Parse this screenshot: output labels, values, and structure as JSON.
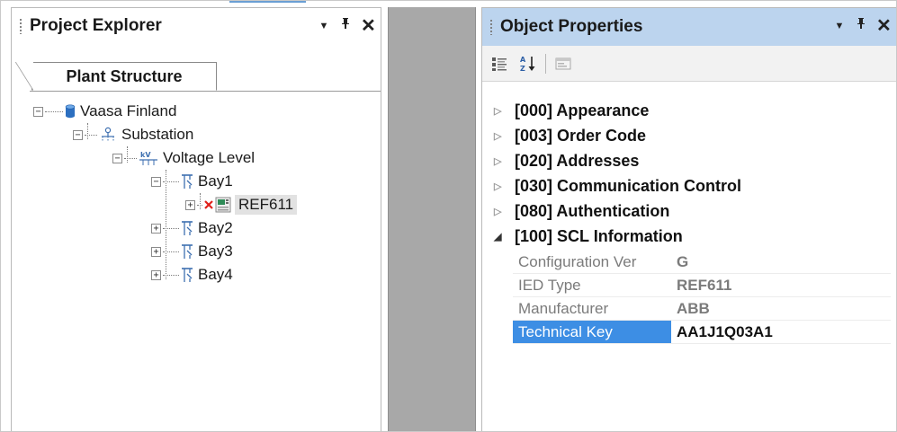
{
  "project_explorer": {
    "title": "Project Explorer",
    "controls": {
      "dropdown": "▾",
      "pin": "ᵖ",
      "close": "✕"
    },
    "tab": "Plant Structure",
    "tree": [
      {
        "label": "Vaasa Finland",
        "icon": "database-icon",
        "expander": "−"
      },
      {
        "label": "Substation",
        "icon": "substation-icon",
        "expander": "−"
      },
      {
        "label": "Voltage Level",
        "icon": "voltage-level-icon",
        "expander": "−"
      },
      {
        "label": "Bay1",
        "icon": "bay-icon",
        "expander": "−"
      },
      {
        "label": "REF611",
        "icon": "ied-icon",
        "expander": "+",
        "status": "error-x"
      },
      {
        "label": "Bay2",
        "icon": "bay-icon",
        "expander": "+"
      },
      {
        "label": "Bay3",
        "icon": "bay-icon",
        "expander": "+"
      },
      {
        "label": "Bay4",
        "icon": "bay-icon",
        "expander": "+"
      }
    ]
  },
  "object_properties": {
    "title": "Object Properties",
    "controls": {
      "dropdown": "▾",
      "pin": "ᵖ",
      "close": "✕"
    },
    "toolbar": [
      "categorized-view-icon",
      "sort-alpha-icon",
      "property-pages-icon"
    ],
    "categories": [
      {
        "label": "[000] Appearance",
        "expanded": false
      },
      {
        "label": "[003] Order Code",
        "expanded": false
      },
      {
        "label": "[020] Addresses",
        "expanded": false
      },
      {
        "label": "[030] Communication Control",
        "expanded": false
      },
      {
        "label": "[080] Authentication",
        "expanded": false
      },
      {
        "label": "[100] SCL Information",
        "expanded": true
      }
    ],
    "scl_properties": [
      {
        "name": "Configuration Ver",
        "value": "G"
      },
      {
        "name": "IED Type",
        "value": "REF611"
      },
      {
        "name": "Manufacturer",
        "value": "ABB"
      },
      {
        "name": "Technical Key",
        "value": "AA1J1Q03A1",
        "selected": true
      }
    ]
  },
  "colors": {
    "header_active": "#bcd4ee",
    "selection": "#3d8ee4",
    "divider": "#a8a8a8",
    "error_x": "#e0211b"
  }
}
